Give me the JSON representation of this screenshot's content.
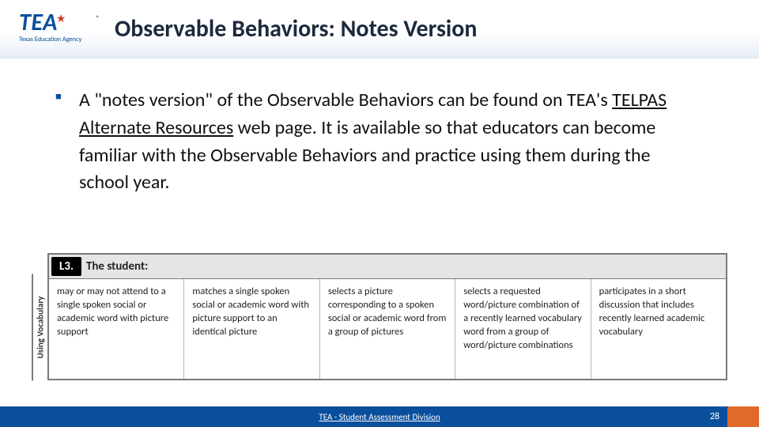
{
  "logo": {
    "text": "TEA",
    "subtitle": "Texas Education Agency"
  },
  "title": "Observable Behaviors: Notes Version",
  "bullet": {
    "pre": "A \"notes version\" of the Observable Behaviors can be found on TEA's ",
    "link": "TELPAS Alternate Resources",
    "post": " web page. It is available so that educators can become familiar with the Observable Behaviors and practice using them during the school year."
  },
  "figure": {
    "row_label": "Using Vocabulary",
    "badge": "L3.",
    "header": "The student:",
    "cells": [
      "may or may not attend to a single spoken social or academic word with picture support",
      "matches a single spoken social or academic word with picture support to an identical picture",
      "selects a picture corresponding to a spoken social or academic word from a group of pictures",
      "selects a requested word/picture combination of a recently learned vocabulary word from a group of word/picture combinations",
      "participates in a short discussion that includes recently learned academic vocabulary"
    ]
  },
  "footer": {
    "text": "TEA - Student Assessment Division",
    "page": "28"
  }
}
